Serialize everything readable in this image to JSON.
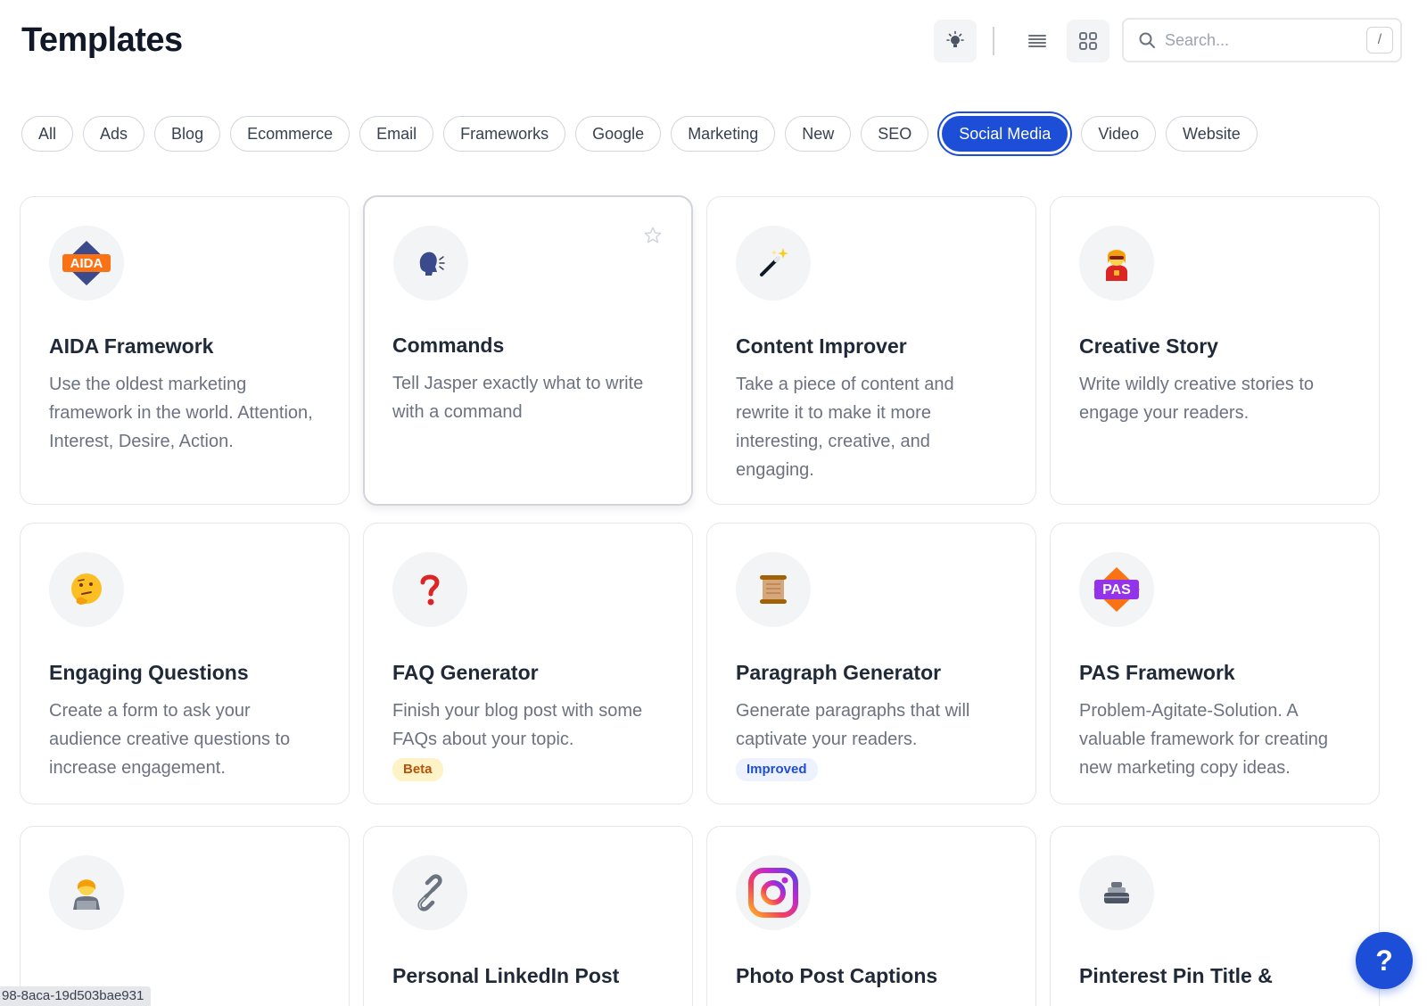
{
  "page": {
    "title": "Templates"
  },
  "toolbar": {
    "search_placeholder": "Search...",
    "search_shortcut": "/"
  },
  "filters": [
    {
      "label": "All",
      "active": false
    },
    {
      "label": "Ads",
      "active": false
    },
    {
      "label": "Blog",
      "active": false
    },
    {
      "label": "Ecommerce",
      "active": false
    },
    {
      "label": "Email",
      "active": false
    },
    {
      "label": "Frameworks",
      "active": false
    },
    {
      "label": "Google",
      "active": false
    },
    {
      "label": "Marketing",
      "active": false
    },
    {
      "label": "New",
      "active": false
    },
    {
      "label": "SEO",
      "active": false
    },
    {
      "label": "Social Media",
      "active": true
    },
    {
      "label": "Video",
      "active": false
    },
    {
      "label": "Website",
      "active": false
    }
  ],
  "cards": [
    {
      "title": "AIDA Framework",
      "description": "Use the oldest marketing framework in the world. Attention, Interest, Desire, Action.",
      "icon": "aida-logo-icon",
      "icon_text": "AIDA",
      "badge": null
    },
    {
      "title": "Commands",
      "description": "Tell Jasper exactly what to write with a command",
      "icon": "speaking-head-icon",
      "badge": null
    },
    {
      "title": "Content Improver",
      "description": "Take a piece of content and rewrite it to make it more interesting, creative, and engaging.",
      "icon": "magic-wand-icon",
      "badge": null
    },
    {
      "title": "Creative Story",
      "description": "Write wildly creative stories to engage your readers.",
      "icon": "superhero-icon",
      "badge": null
    },
    {
      "title": "Engaging Questions",
      "description": "Create a form to ask your audience creative questions to increase engagement.",
      "icon": "thinking-face-icon",
      "badge": null
    },
    {
      "title": "FAQ Generator",
      "description": "Finish your blog post with some FAQs about your topic.",
      "icon": "question-mark-icon",
      "badge": "Beta"
    },
    {
      "title": "Paragraph Generator",
      "description": "Generate paragraphs that will captivate your readers.",
      "icon": "scroll-icon",
      "badge": "Improved"
    },
    {
      "title": "PAS Framework",
      "description": "Problem-Agitate-Solution. A valuable framework for creating new marketing copy ideas.",
      "icon": "pas-logo-icon",
      "icon_text": "PAS",
      "badge": null
    },
    {
      "title": "",
      "description": "",
      "icon": "technologist-icon",
      "badge": null
    },
    {
      "title": "Personal LinkedIn Post",
      "description": "",
      "icon": "link-icon",
      "badge": null
    },
    {
      "title": "Photo Post Captions",
      "description": "",
      "icon": "instagram-icon",
      "badge": null
    },
    {
      "title": "Pinterest Pin Title &",
      "description": "",
      "icon": "pin-icon",
      "badge": null
    }
  ],
  "help": {
    "label": "?"
  },
  "id_tag": "98-8aca-19d503bae931",
  "colors": {
    "accent": "#1d4ed8",
    "beta_bg": "#fef3c7",
    "beta_text": "#b45309",
    "improved_bg": "#eef2ff"
  }
}
